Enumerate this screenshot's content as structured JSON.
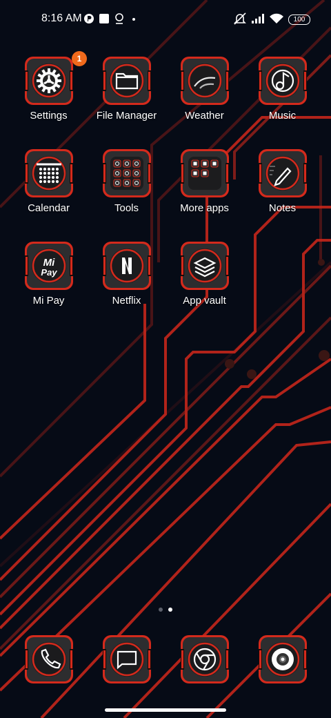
{
  "status_bar": {
    "time": "8:16 AM",
    "battery": "100",
    "left_icons": [
      "vpn-icon",
      "square-icon",
      "location-pin-icon",
      "dot-icon"
    ],
    "right_icons": [
      "silent-bell-icon",
      "signal-icon",
      "wifi-icon",
      "battery-icon"
    ]
  },
  "apps": [
    {
      "label": "Settings",
      "icon": "settings-gear-icon",
      "badge": "1"
    },
    {
      "label": "File Manager",
      "icon": "folder-icon"
    },
    {
      "label": "Weather",
      "icon": "weather-icon"
    },
    {
      "label": "Music",
      "icon": "music-note-icon"
    },
    {
      "label": "Calendar",
      "icon": "calendar-icon"
    },
    {
      "label": "Tools",
      "icon": "tools-folder-icon"
    },
    {
      "label": "More apps",
      "icon": "more-apps-folder-icon"
    },
    {
      "label": "Notes",
      "icon": "pencil-icon"
    },
    {
      "label": "Mi Pay",
      "icon": "mi-pay-icon"
    },
    {
      "label": "Netflix",
      "icon": "netflix-icon"
    },
    {
      "label": "App vault",
      "icon": "layers-icon"
    }
  ],
  "mi_pay_text": {
    "top": "Mi",
    "bottom": "Pay"
  },
  "page_indicator": {
    "pages": 2,
    "current": 2
  },
  "dock": [
    {
      "icon": "phone-icon"
    },
    {
      "icon": "message-icon"
    },
    {
      "icon": "chrome-icon"
    },
    {
      "icon": "camera-icon"
    }
  ],
  "colors": {
    "accent_red": "#d42a1c",
    "background": "#060b16",
    "badge": "#f06a1c",
    "icon_body": "#2d2d2f"
  }
}
